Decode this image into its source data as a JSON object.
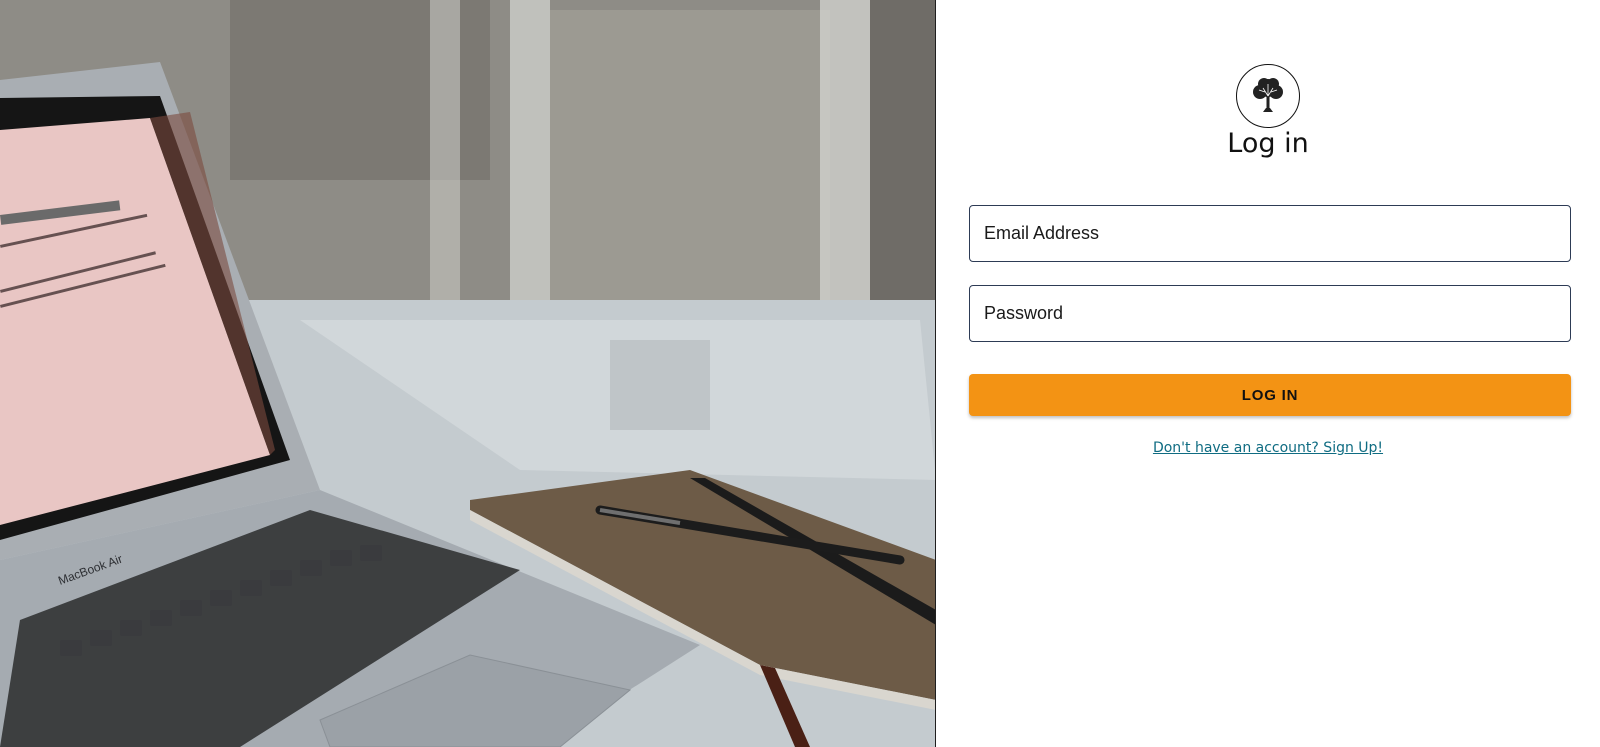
{
  "hero_image": {
    "icon": "laptop-notebook-photo"
  },
  "logo": {
    "icon": "tree-icon"
  },
  "form": {
    "title": "Log in",
    "email_placeholder": "Email Address",
    "email_value": "",
    "password_placeholder": "Password",
    "password_value": "",
    "submit_label": "LOG IN",
    "signup_link": "Don't have an account? Sign Up!"
  },
  "colors": {
    "accent": "#f39314",
    "field_border": "#2d3b55",
    "link": "#0f6c82"
  }
}
